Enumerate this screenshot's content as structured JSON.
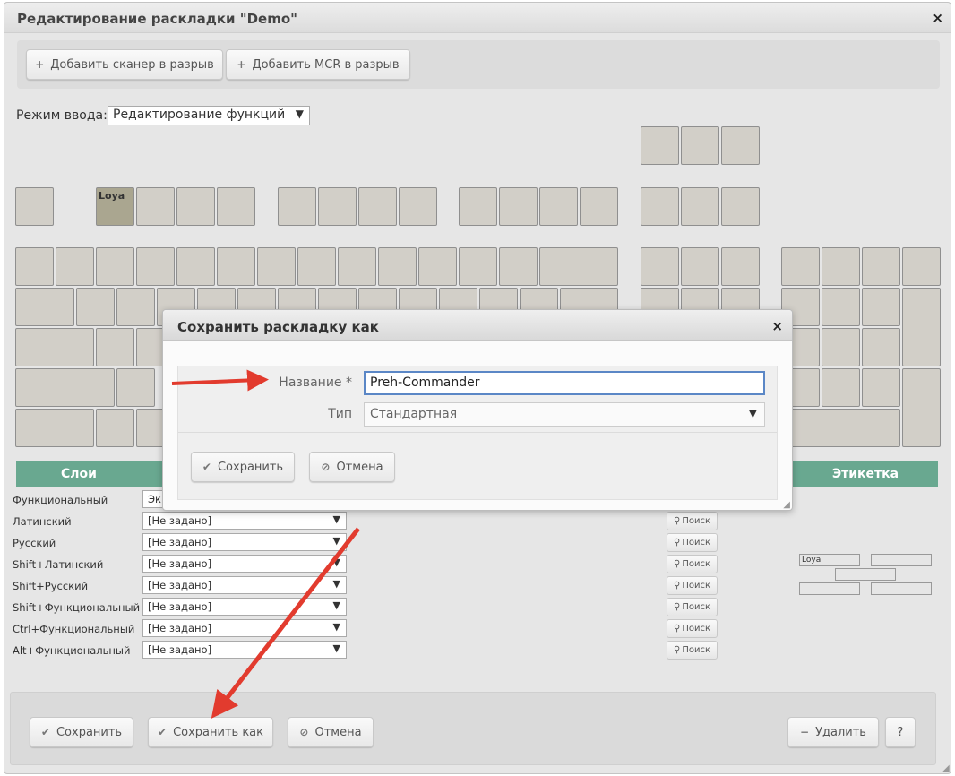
{
  "window": {
    "title": "Редактирование раскладки \"Demo\"",
    "close": "×"
  },
  "toolbar": {
    "add_scanner": "Добавить сканер в разрыв",
    "add_mcr": "Добавить MCR в разрыв",
    "plus_icon": "+"
  },
  "mode": {
    "label": "Режим ввода:",
    "value": "Редактирование функций",
    "arrow": "▼"
  },
  "keyboard": {
    "active_key_label": "Loya"
  },
  "layers": {
    "header": "Слои",
    "label_header": "Этикетка",
    "rows": [
      {
        "name": "Функциональный",
        "value": "Эк"
      },
      {
        "name": "Латинский",
        "value": "[Не задано]"
      },
      {
        "name": "Русский",
        "value": "[Не задано]"
      },
      {
        "name": "Shift+Латинский",
        "value": "[Не задано]"
      },
      {
        "name": "Shift+Русский",
        "value": "[Не задано]"
      },
      {
        "name": "Shift+Функциональный",
        "value": "[Не задано]"
      },
      {
        "name": "Ctrl+Функциональный",
        "value": "[Не задано]"
      },
      {
        "name": "Alt+Функциональный",
        "value": "[Не задано]"
      }
    ],
    "search_label": "Поиск",
    "search_icon": "⚲"
  },
  "label_preview": {
    "first": "Loya"
  },
  "footer": {
    "save": "Сохранить",
    "save_as": "Сохранить как",
    "cancel": "Отмена",
    "delete": "Удалить",
    "help": "?",
    "check_icon": "✔",
    "cancel_icon": "⊘",
    "minus_icon": "−"
  },
  "dialog": {
    "title": "Сохранить раскладку как",
    "close": "×",
    "name_label": "Название *",
    "name_value": "Preh-Commander",
    "type_label": "Тип",
    "type_value": "Стандартная",
    "type_arrow": "▼",
    "save": "Сохранить",
    "cancel": "Отмена"
  },
  "colors": {
    "accent": "#69a890",
    "annotation": "#e23b2e",
    "input_focus": "#5b87c6"
  }
}
